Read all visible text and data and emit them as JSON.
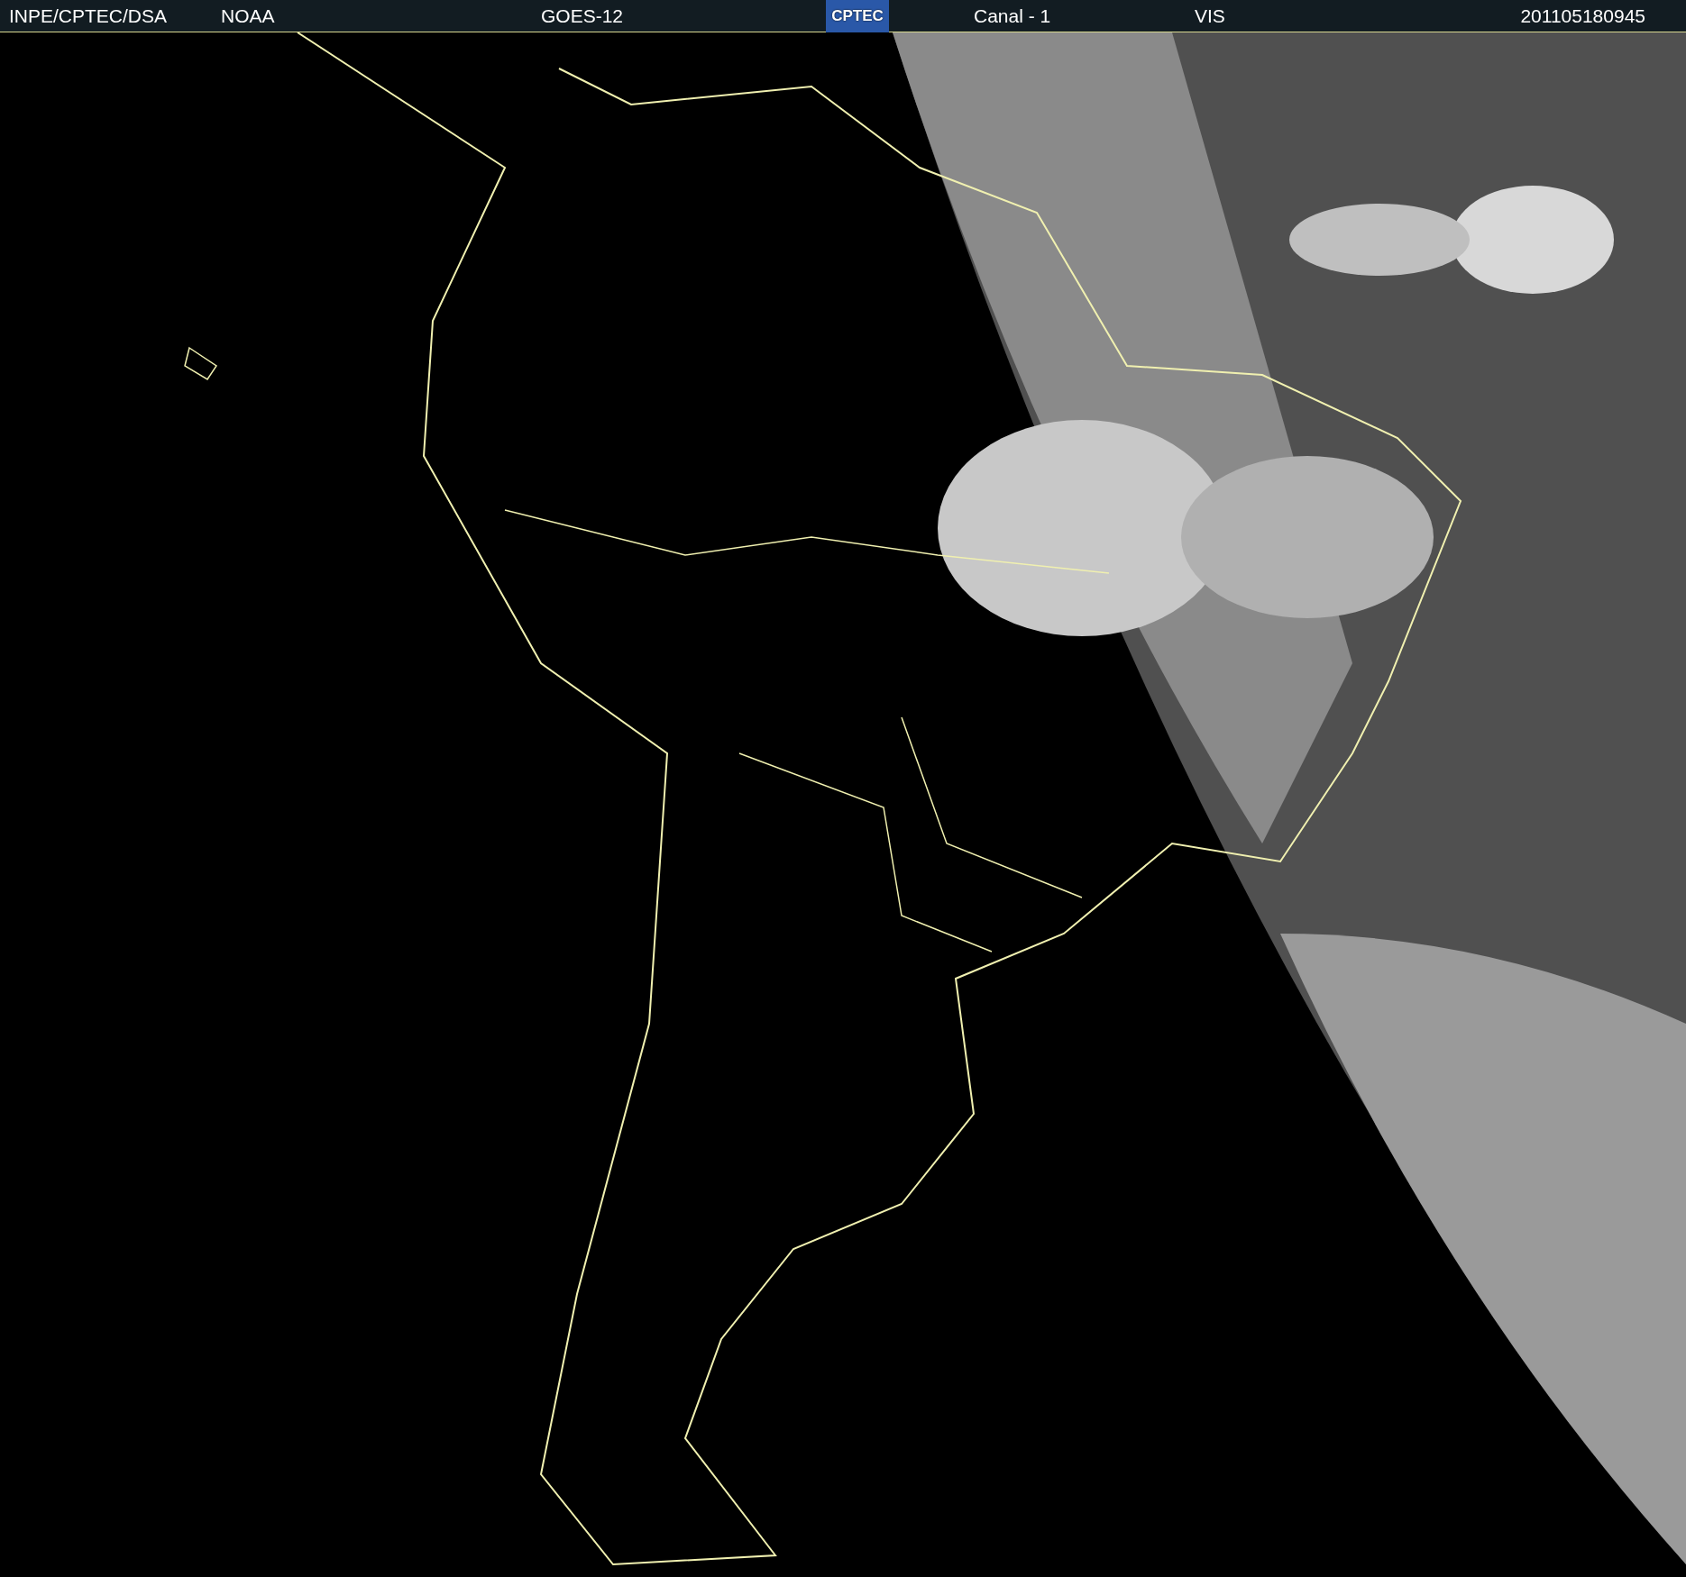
{
  "header": {
    "source": "INPE/CPTEC/DSA",
    "agency": "NOAA",
    "satellite": "GOES-12",
    "logo": "CPTEC",
    "channel": "Canal - 1",
    "band": "VIS",
    "timestamp": "201105180945"
  }
}
